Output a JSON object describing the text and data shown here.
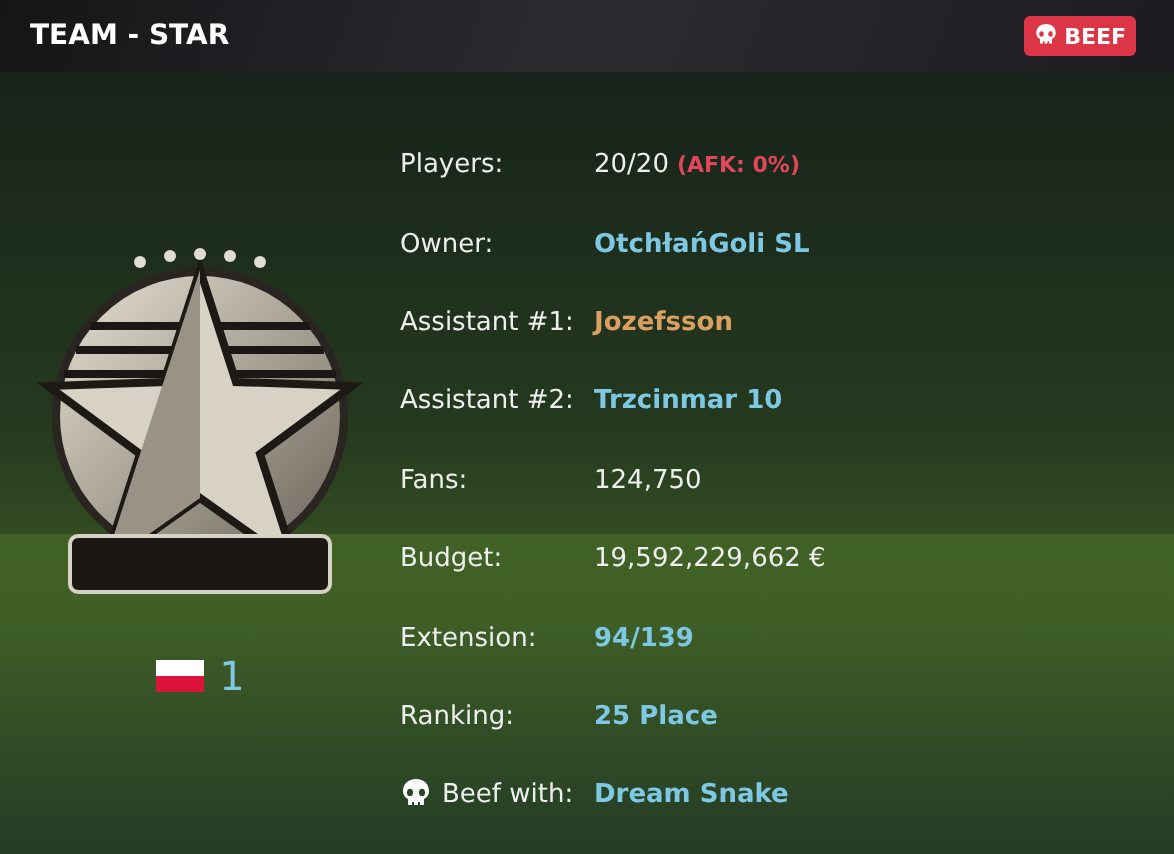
{
  "header": {
    "title": "TEAM - STAR",
    "badge": "BEEF"
  },
  "team": {
    "rank": "1"
  },
  "rows": [
    {
      "label": "Players:",
      "value": "20/20",
      "note": "(AFK: 0%)",
      "kind": "plain"
    },
    {
      "label": "Owner:",
      "value": "OtchłańGoli SL",
      "kind": "link"
    },
    {
      "label": "Assistant #1:",
      "value": "Jozefsson",
      "kind": "gold"
    },
    {
      "label": "Assistant #2:",
      "value": "Trzcinmar 10",
      "kind": "link"
    },
    {
      "label": "Fans:",
      "value": "124,750",
      "kind": "plain"
    },
    {
      "label": "Budget:",
      "value": "19,592,229,662 €",
      "kind": "plain"
    },
    {
      "label": "Extension:",
      "value": "94/139",
      "kind": "link"
    },
    {
      "label": "Ranking:",
      "value": "25 Place",
      "kind": "link"
    },
    {
      "label": "Beef with:",
      "value": "Dream Snake",
      "kind": "beef"
    }
  ]
}
